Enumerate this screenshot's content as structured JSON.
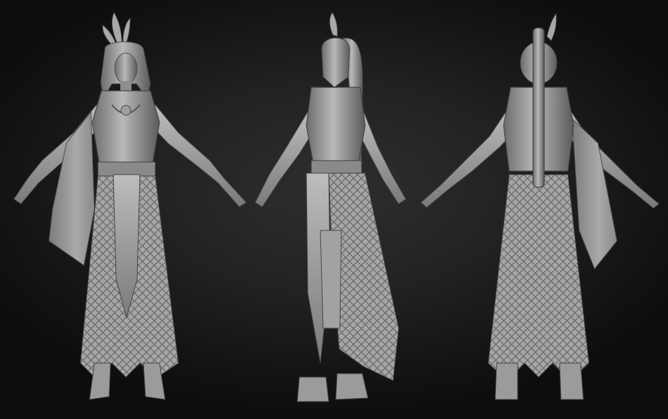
{
  "scene": {
    "background_color": "#1c1c1c",
    "material_color": "#9a9a9a",
    "views": [
      {
        "view": "front"
      },
      {
        "view": "side"
      },
      {
        "view": "back"
      }
    ]
  }
}
